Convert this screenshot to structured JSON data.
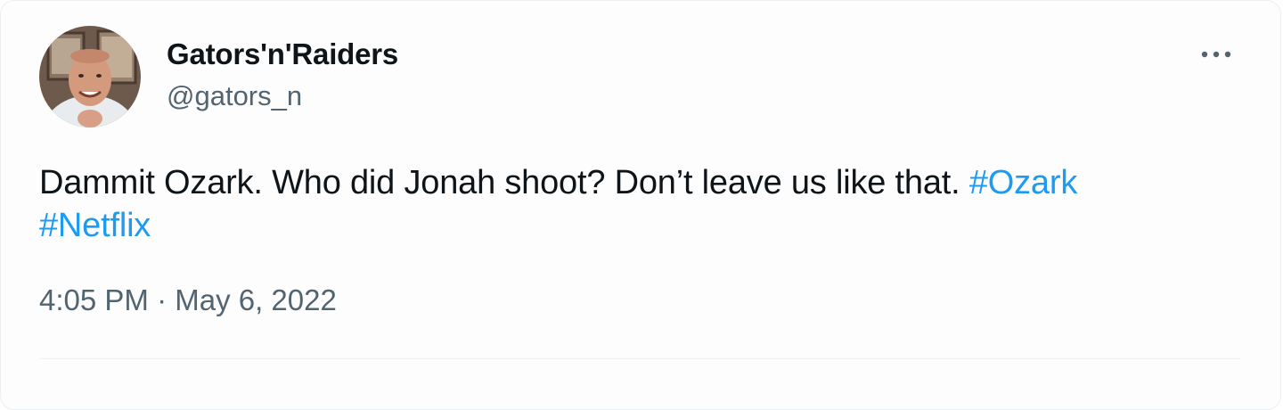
{
  "tweet": {
    "author": {
      "display_name": "Gators'n'Raiders",
      "handle": "@gators_n",
      "avatar_icon": "user-avatar-photo"
    },
    "more_icon": "more-horizontal-icon",
    "text": "Dammit Ozark. Who did Jonah shoot? Don’t leave us like that. ",
    "hashtags": [
      "#Ozark",
      "#Netflix"
    ],
    "time": "4:05 PM",
    "separator": " · ",
    "date": "May 6, 2022"
  },
  "colors": {
    "text": "#0f1419",
    "secondary": "#536471",
    "link": "#1d9bf0",
    "divider": "#eff3f4"
  }
}
